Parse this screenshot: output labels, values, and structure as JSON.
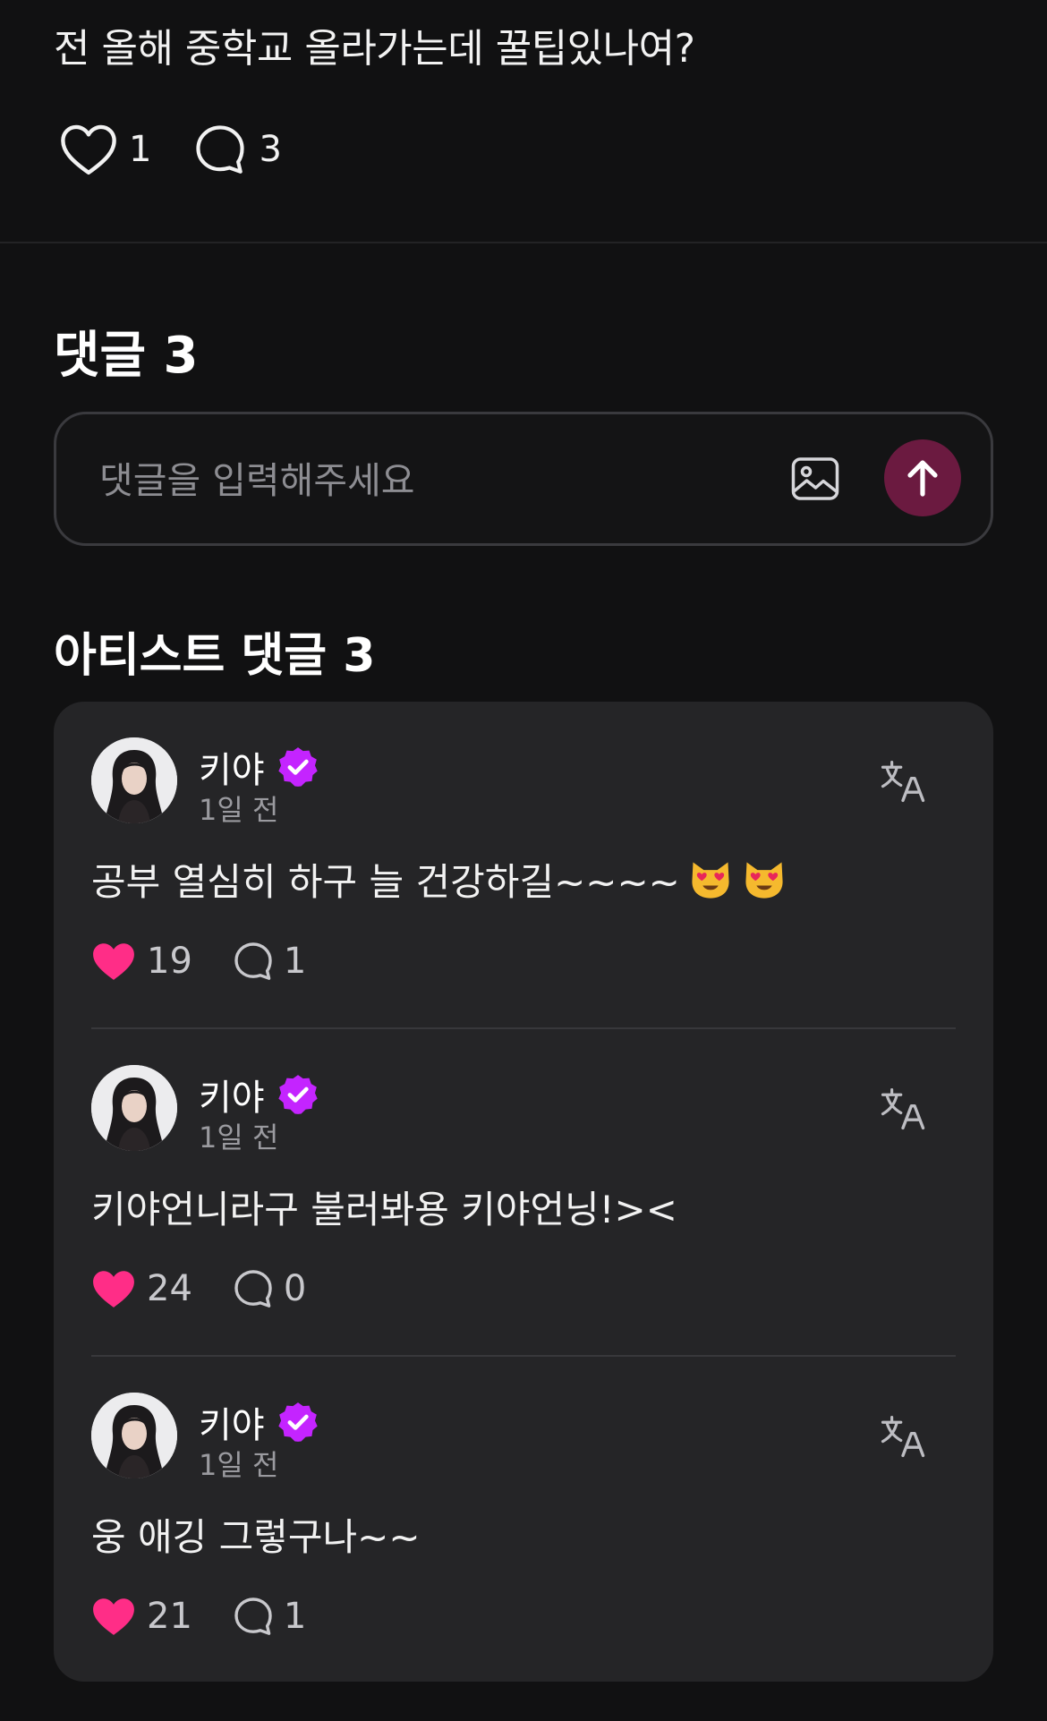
{
  "post": {
    "text": "전 올해 중학교 올라가는데 꿀팁있나여?",
    "likes": "1",
    "comments": "3"
  },
  "comments_section": {
    "title": "댓글 3",
    "input_placeholder": "댓글을 입력해주세요"
  },
  "artist_section": {
    "title": "아티스트 댓글 3"
  },
  "artist_comments": [
    {
      "name": "키야",
      "time": "1일 전",
      "text": "공부 열심히 하구 늘 건강하길~~~~",
      "emoji_count": 2,
      "likes": "19",
      "replies": "1"
    },
    {
      "name": "키야",
      "time": "1일 전",
      "text": "키야언니라구 불러봐용 키야언닝!><",
      "emoji_count": 0,
      "likes": "24",
      "replies": "0"
    },
    {
      "name": "키야",
      "time": "1일 전",
      "text": "웅 애깅 그렇구나~~",
      "emoji_count": 0,
      "likes": "21",
      "replies": "1"
    }
  ],
  "colors": {
    "background": "#111112",
    "card": "#252527",
    "like_pink": "#ff2d87",
    "badge_purple": "#c424ff",
    "send_button": "#6b1a40"
  },
  "icons": {
    "post_like": "heart-outline-icon",
    "post_comment": "comment-bubble-icon",
    "attach": "image-icon",
    "send": "arrow-up-icon",
    "verified": "verified-badge-icon",
    "translate": "translate-icon",
    "comment_like": "heart-filled-icon",
    "reply": "reply-bubble-icon",
    "emoji": "heart-eyes-cat-emoji"
  }
}
